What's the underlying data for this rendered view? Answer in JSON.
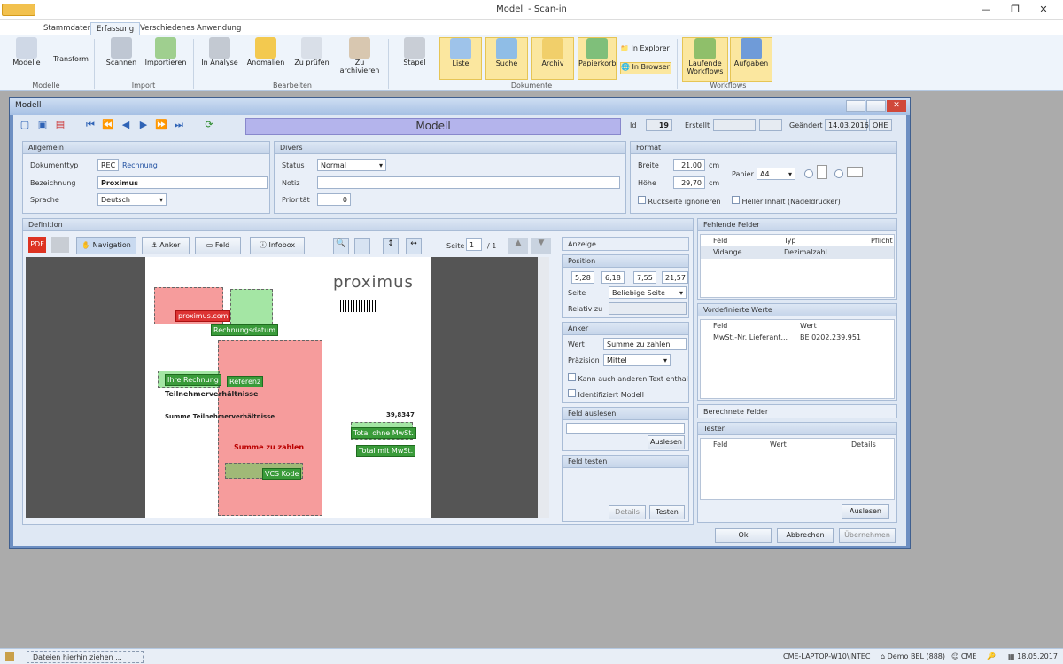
{
  "window": {
    "title": "Modell - Scan-in"
  },
  "ribbon_tabs": [
    "Stammdaten",
    "Erfassung",
    "Verschiedenes",
    "Anwendung"
  ],
  "ribbon": {
    "modelle": "Modelle",
    "transform": "Transform",
    "grp_modelle": "Modelle",
    "scannen": "Scannen",
    "importieren": "Importieren",
    "grp_import": "Import",
    "in_analyse": "In Analyse",
    "anomalien": "Anomalien",
    "zu_pruefen": "Zu prüfen",
    "zu_archivieren": "Zu archivieren",
    "grp_bearbeiten": "Bearbeiten",
    "stapel": "Stapel",
    "liste": "Liste",
    "suche": "Suche",
    "archiv": "Archiv",
    "papierkorb": "Papierkorb",
    "in_explorer": "In Explorer",
    "in_browser": "In Browser",
    "grp_dokumente": "Dokumente",
    "laufende_workflows": "Laufende Workflows",
    "aufgaben": "Aufgaben",
    "grp_workflows": "Workflows"
  },
  "modal": {
    "title": "Modell",
    "heading": "Modell",
    "id_label": "Id",
    "id_value": "19",
    "erstellt_label": "Erstellt",
    "geaendert_label": "Geändert",
    "geaendert_date": "14.03.2016",
    "geaendert_user": "OHE"
  },
  "allgemein": {
    "title": "Allgemein",
    "doktyp_label": "Dokumenttyp",
    "doktyp_code": "REC",
    "doktyp_name": "Rechnung",
    "bez_label": "Bezeichnung",
    "bez_value": "Proximus",
    "sprache_label": "Sprache",
    "sprache_value": "Deutsch"
  },
  "divers": {
    "title": "Divers",
    "status_label": "Status",
    "status_value": "Normal",
    "notiz_label": "Notiz",
    "prio_label": "Priorität",
    "prio_value": "0"
  },
  "format": {
    "title": "Format",
    "breite_label": "Breite",
    "breite_value": "21,00",
    "hoehe_label": "Höhe",
    "hoehe_value": "29,70",
    "unit": "cm",
    "papier_label": "Papier",
    "papier_value": "A4",
    "rueck": "Rückseite ignorieren",
    "heller": "Heller Inhalt (Nadeldrucker)"
  },
  "definition": {
    "title": "Definition",
    "navigation": "Navigation",
    "anker": "Anker",
    "feld": "Feld",
    "infobox": "Infobox",
    "seite_label": "Seite",
    "seite_value": "1",
    "seite_total": "/ 1"
  },
  "doc": {
    "brand": "proximus",
    "tags": [
      "proximus.com",
      "Rechnungsdatum",
      "Ihre Rechnung",
      "Referenz",
      "Total ohne MwSt.",
      "Summe zu zahlen",
      "Total mit MwSt.",
      "VCS Kode"
    ],
    "line1": "Teilnehmerverhältnisse",
    "line2": "Summe Teilnehmerverhältnisse",
    "amount": "39,8347"
  },
  "anzeige": {
    "title": "Anzeige"
  },
  "position": {
    "title": "Position",
    "v1": "5,28",
    "v2": "6,18",
    "v3": "7,55",
    "v4": "21,57",
    "seite_label": "Seite",
    "seite_value": "Beliebige Seite",
    "relativ_label": "Relativ zu"
  },
  "anker": {
    "title": "Anker",
    "wert_label": "Wert",
    "wert_value": "Summe zu zahlen",
    "praez_label": "Präzision",
    "praez_value": "Mittel",
    "kann": "Kann auch anderen Text enthalte",
    "ident": "Identifiziert Modell"
  },
  "feld_auslesen": {
    "title": "Feld auslesen",
    "btn": "Auslesen"
  },
  "feld_testen": {
    "title": "Feld testen",
    "details": "Details",
    "testen": "Testen"
  },
  "fehlende": {
    "title": "Fehlende Felder",
    "cols": [
      "Feld",
      "Typ",
      "Pflicht"
    ],
    "row": [
      "Vidange",
      "Dezimalzahl"
    ]
  },
  "vordef": {
    "title": "Vordefinierte Werte",
    "cols": [
      "Feld",
      "Wert"
    ],
    "row": [
      "MwSt.-Nr. Lieferant...",
      "BE 0202.239.951"
    ]
  },
  "berechnete": {
    "title": "Berechnete Felder"
  },
  "testen": {
    "title": "Testen",
    "cols": [
      "Feld",
      "Wert",
      "Details"
    ],
    "btn": "Auslesen"
  },
  "footer": {
    "ok": "Ok",
    "abbrechen": "Abbrechen",
    "uebernehmen": "Übernehmen"
  },
  "status": {
    "drop": "Dateien hierhin ziehen ...",
    "host": "CME-LAPTOP-W10\\INTEC",
    "db": "Demo BEL (888)",
    "user": "CME",
    "date": "18.05.2017"
  }
}
